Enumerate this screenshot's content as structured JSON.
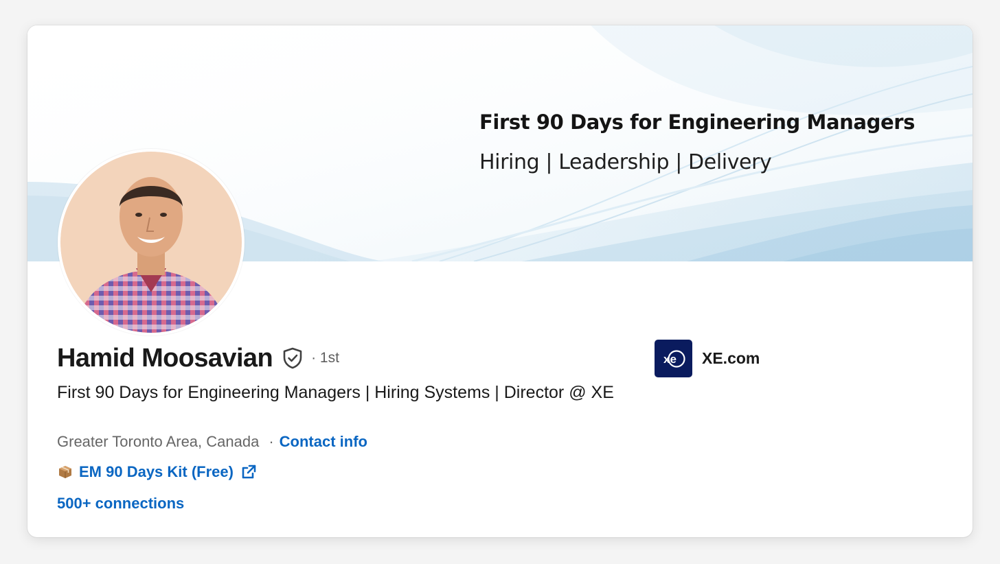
{
  "banner": {
    "title": "First 90 Days for Engineering Managers",
    "subtitle": "Hiring | Leadership | Delivery"
  },
  "profile": {
    "name": "Hamid Moosavian",
    "degree": "· 1st",
    "headline": "First 90 Days for Engineering Managers | Hiring Systems | Director @ XE",
    "location": "Greater Toronto Area, Canada",
    "separator": "·",
    "contact_label": "Contact info",
    "website_label": "EM 90 Days Kit (Free)",
    "connections": "500+ connections"
  },
  "company": {
    "name": "XE.com",
    "logo_text": "xe",
    "logo_color": "#0a1b5e"
  },
  "icons": {
    "verified": "verified-shield-icon",
    "package": "package-icon",
    "external_link": "external-link-icon"
  },
  "colors": {
    "link": "#0a66c2",
    "text": "#191919",
    "muted": "#666666"
  }
}
